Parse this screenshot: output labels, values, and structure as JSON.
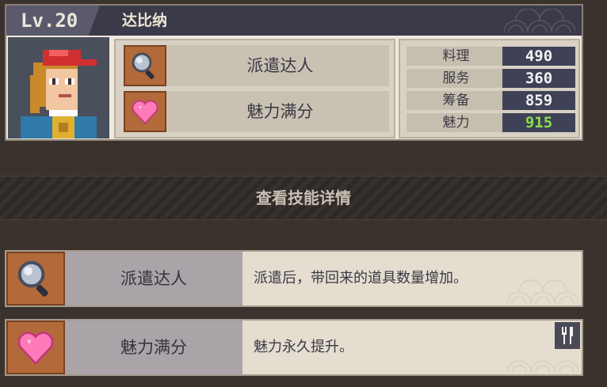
{
  "character": {
    "level": "Lv.20",
    "name": "达比纳",
    "traits": [
      {
        "label": "派遣达人",
        "icon": "magnifier-icon"
      },
      {
        "label": "魅力满分",
        "icon": "heart-icon"
      }
    ],
    "stats": [
      {
        "name": "料理",
        "value": "490",
        "highlight": false
      },
      {
        "name": "服务",
        "value": "360",
        "highlight": false
      },
      {
        "name": "筹备",
        "value": "859",
        "highlight": false
      },
      {
        "name": "魅力",
        "value": "915",
        "highlight": true
      }
    ]
  },
  "section_title": "查看技能详情",
  "skills": [
    {
      "name": "派遣达人",
      "description": "派遣后，带回来的道具数量增加。",
      "icon": "magnifier-icon"
    },
    {
      "name": "魅力满分",
      "description": "魅力永久提升。",
      "icon": "heart-icon",
      "category_icon": "fork-knife-icon"
    }
  ],
  "colors": {
    "highlight_value": "#86e04a",
    "icon_tile": "#b26a3a",
    "header": "#3a3a48"
  }
}
